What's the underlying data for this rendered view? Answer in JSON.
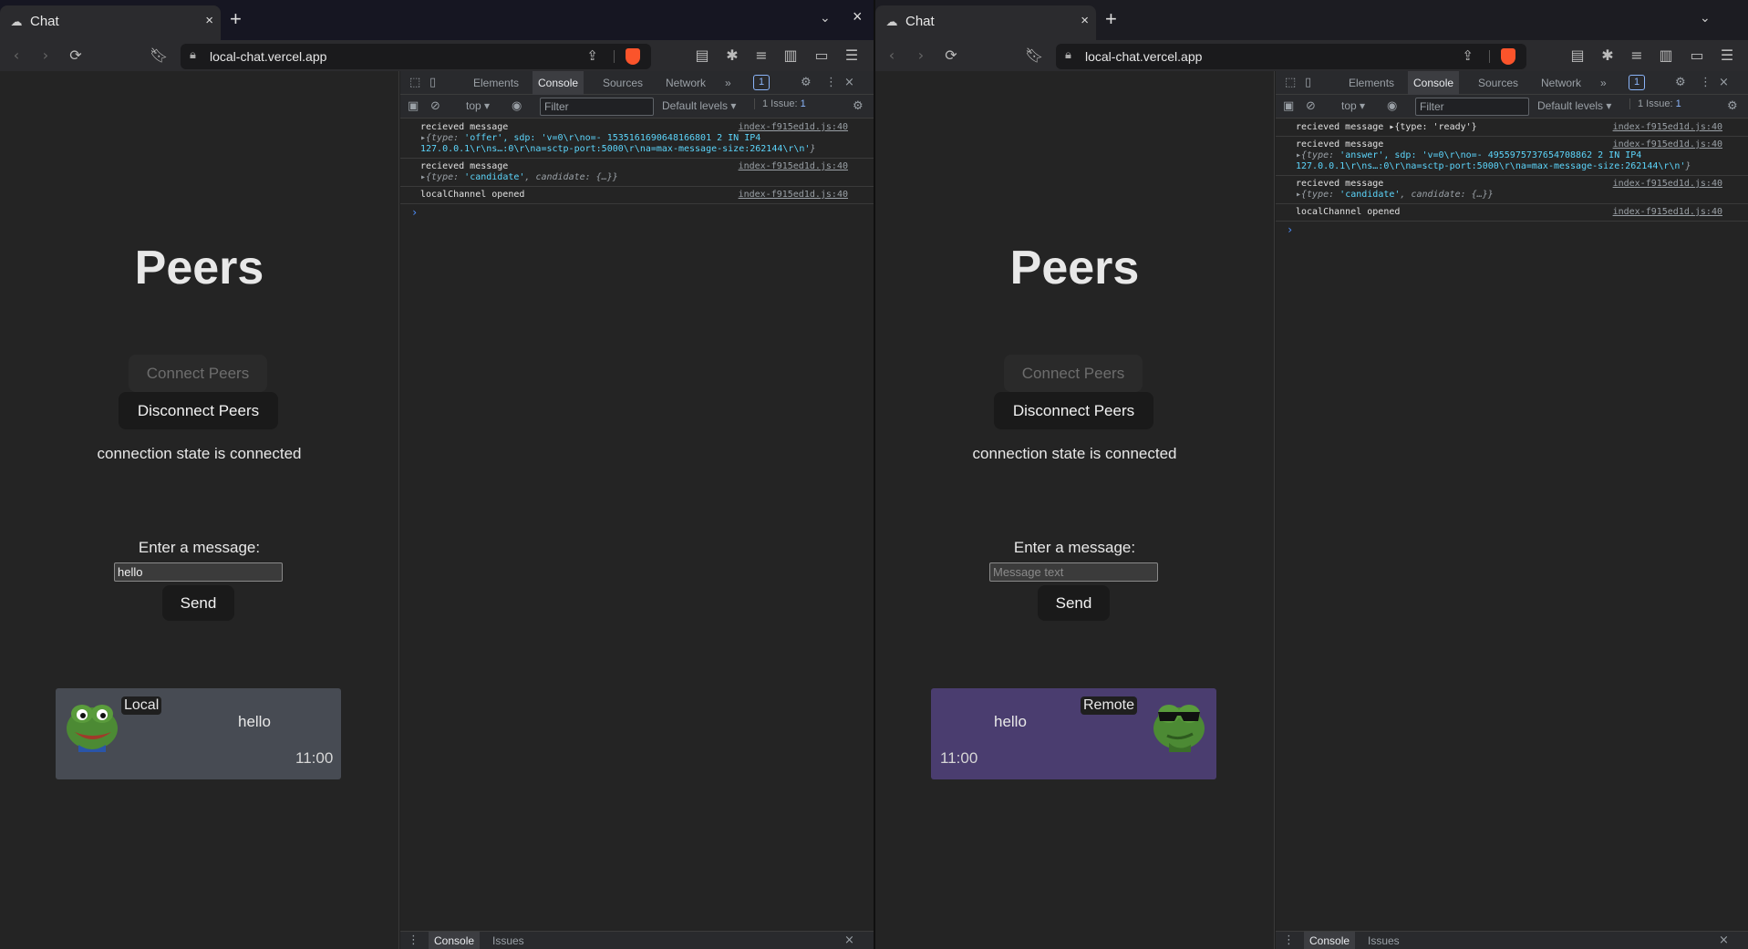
{
  "windows": {
    "left": {
      "tab_title": "Chat",
      "url": "local-chat.vercel.app",
      "page": {
        "title": "Peers",
        "connect_label": "Connect Peers",
        "disconnect_label": "Disconnect Peers",
        "connection_state": "connection state is connected",
        "message_label": "Enter a message:",
        "message_value": "hello",
        "message_placeholder": "Message text",
        "send_label": "Send",
        "bubble": {
          "name": "Local",
          "text": "hello",
          "time": "11:00"
        }
      },
      "devtools": {
        "tabs": [
          "Elements",
          "Console",
          "Sources",
          "Network"
        ],
        "more": "»",
        "badge": "1",
        "context": "top ▾",
        "filter_placeholder": "Filter",
        "levels": "Default levels ▾",
        "issue_label": "1 Issue:",
        "issue_count": "1",
        "logs": [
          {
            "text": "recieved message",
            "detail_prefix": "▸{type: ",
            "detail_str": "'offer', sdp: 'v=0\\r\\no=- 1535161690648166801 2 IN IP4 127.0.0.1\\r\\ns…:0\\r\\na=sctp-port:5000\\r\\na=max-message-size:262144\\r\\n'",
            "detail_suffix": "}",
            "source": "index-f915ed1d.js:40"
          },
          {
            "text": "recieved message",
            "detail_prefix": "▸{type: ",
            "detail_str": "'candidate'",
            "detail_suffix": ", candidate: {…}}",
            "source": "index-f915ed1d.js:40"
          },
          {
            "text": "localChannel opened",
            "detail_prefix": "",
            "detail_str": "",
            "detail_suffix": "",
            "source": "index-f915ed1d.js:40"
          }
        ],
        "drawer_tabs": [
          "Console",
          "Issues"
        ]
      }
    },
    "right": {
      "tab_title": "Chat",
      "url": "local-chat.vercel.app",
      "page": {
        "title": "Peers",
        "connect_label": "Connect Peers",
        "disconnect_label": "Disconnect Peers",
        "connection_state": "connection state is connected",
        "message_label": "Enter a message:",
        "message_value": "",
        "message_placeholder": "Message text",
        "send_label": "Send",
        "bubble": {
          "name": "Remote",
          "text": "hello",
          "time": "11:00"
        }
      },
      "devtools": {
        "tabs": [
          "Elements",
          "Console",
          "Sources",
          "Network"
        ],
        "more": "»",
        "badge": "1",
        "context": "top ▾",
        "filter_placeholder": "Filter",
        "levels": "Default levels ▾",
        "issue_label": "1 Issue:",
        "issue_count": "1",
        "logs": [
          {
            "text": "recieved message ▸{type: 'ready'}",
            "detail_prefix": "",
            "detail_str": "",
            "detail_suffix": "",
            "source": "index-f915ed1d.js:40"
          },
          {
            "text": "recieved message",
            "detail_prefix": "▸{type: ",
            "detail_str": "'answer', sdp: 'v=0\\r\\no=- 4955975737654708862 2 IN IP4 127.0.0.1\\r\\ns…:0\\r\\na=sctp-port:5000\\r\\na=max-message-size:262144\\r\\n'",
            "detail_suffix": "}",
            "source": "index-f915ed1d.js:40"
          },
          {
            "text": "recieved message",
            "detail_prefix": "▸{type: ",
            "detail_str": "'candidate'",
            "detail_suffix": ", candidate: {…}}",
            "source": "index-f915ed1d.js:40"
          },
          {
            "text": "localChannel opened",
            "detail_prefix": "",
            "detail_str": "",
            "detail_suffix": "",
            "source": "index-f915ed1d.js:40"
          }
        ],
        "drawer_tabs": [
          "Console",
          "Issues"
        ]
      }
    }
  },
  "icons": {
    "favicon": "chat-favicon-icon",
    "close": "×",
    "new_tab": "+",
    "tab_list": "⌄",
    "back": "‹",
    "forward": "›",
    "reload": "⟳",
    "bookmark": "bookmark-icon",
    "lock": "lock-icon",
    "share": "share-icon",
    "brave": "brave-shield-icon",
    "extensions": "puzzle-icon",
    "menu": "☰"
  },
  "colors": {
    "local_bubble": "#474b53",
    "remote_bubble": "#4a3d6f",
    "brave_orange": "#fb542b",
    "devtools_accent": "#8ab4f8"
  }
}
